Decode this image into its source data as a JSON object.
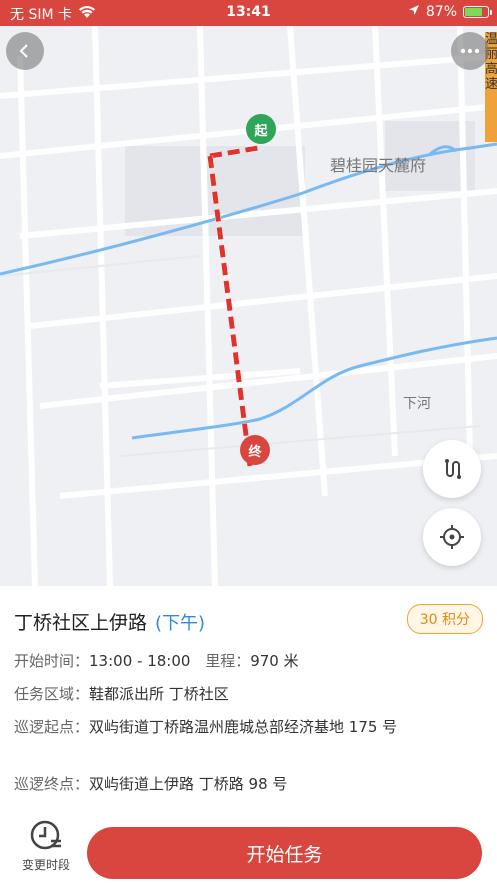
{
  "status_bar": {
    "carrier": "无 SIM 卡",
    "time": "13:41",
    "battery": "87%",
    "battery_level": 0.87
  },
  "map": {
    "labels": {
      "community": "碧桂园天麓府",
      "village": "下河",
      "highway": "温丽高速"
    },
    "start_pin": "起",
    "end_pin": "终"
  },
  "task": {
    "title": "丁桥社区上伊路",
    "period": "(下午)",
    "points": "30 积分",
    "time_label": "开始时间：",
    "time_value": "13:00 - 18:00",
    "distance_label": "里程：",
    "distance_value": "970 米",
    "area_label": "任务区域：",
    "area_value": "鞋都派出所 丁桥社区",
    "start_label": "巡逻起点：",
    "start_value": "双屿街道丁桥路温州鹿城总部经济基地 175 号",
    "end_label": "巡逻终点：",
    "end_value": "双屿街道上伊路 丁桥路 98 号"
  },
  "actions": {
    "change_period": "变更时段",
    "start_task": "开始任务"
  }
}
